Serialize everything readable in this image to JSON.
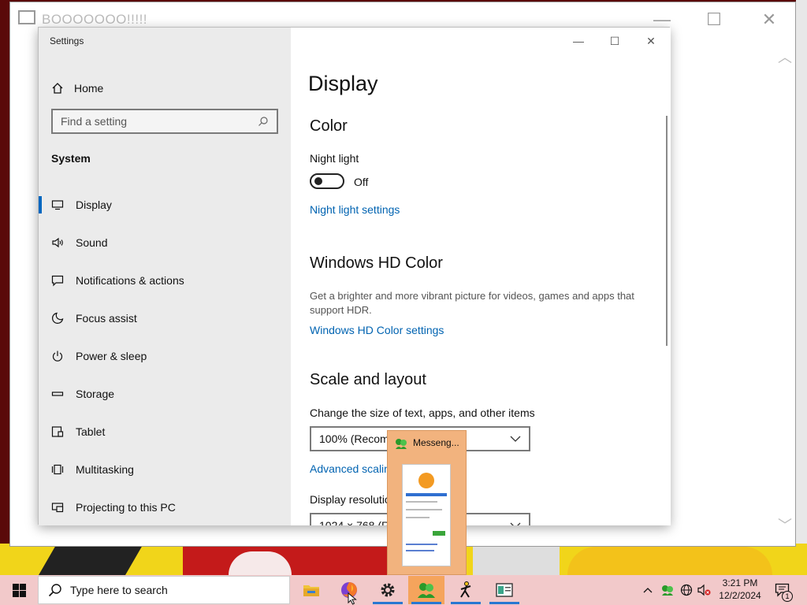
{
  "back_window": {
    "title": "BOOOOOOO!!!!!"
  },
  "settings": {
    "window_title": "Settings",
    "home_label": "Home",
    "search_placeholder": "Find a setting",
    "section_label": "System",
    "nav": [
      {
        "label": "Display",
        "icon": "monitor-icon",
        "active": true
      },
      {
        "label": "Sound",
        "icon": "speaker-icon"
      },
      {
        "label": "Notifications & actions",
        "icon": "notification-icon"
      },
      {
        "label": "Focus assist",
        "icon": "moon-icon"
      },
      {
        "label": "Power & sleep",
        "icon": "power-icon"
      },
      {
        "label": "Storage",
        "icon": "storage-icon"
      },
      {
        "label": "Tablet",
        "icon": "tablet-icon"
      },
      {
        "label": "Multitasking",
        "icon": "multitasking-icon"
      },
      {
        "label": "Projecting to this PC",
        "icon": "projector-icon"
      }
    ],
    "content": {
      "page_title": "Display",
      "color_heading": "Color",
      "night_light_label": "Night light",
      "night_light_state": "Off",
      "night_light_link": "Night light settings",
      "hdr_heading": "Windows HD Color",
      "hdr_desc": "Get a brighter and more vibrant picture for videos, games and apps that support HDR.",
      "hdr_link": "Windows HD Color settings",
      "scale_heading": "Scale and layout",
      "scale_label": "Change the size of text, apps, and other items",
      "scale_value": "100% (Recomm",
      "advanced_link": "Advanced scalin",
      "resolution_label": "Display resolutio",
      "resolution_value": "1024 × 768 (Re"
    }
  },
  "thumbnail": {
    "label": "Messeng..."
  },
  "taskbar": {
    "search_placeholder": "Type here to search",
    "apps": [
      {
        "name": "file-explorer-icon",
        "running": false
      },
      {
        "name": "firefox-icon",
        "running": false
      },
      {
        "name": "settings-gear-icon",
        "running": true
      },
      {
        "name": "messenger-icon",
        "running": true,
        "active": true
      },
      {
        "name": "aim-icon",
        "running": true
      },
      {
        "name": "window-app-icon",
        "running": true
      }
    ],
    "time": "3:21 PM",
    "date": "12/2/2024",
    "notification_count": "1"
  },
  "colors": {
    "accent": "#0067c0",
    "link": "#0063b1",
    "taskbar": "#f2c9ca"
  }
}
